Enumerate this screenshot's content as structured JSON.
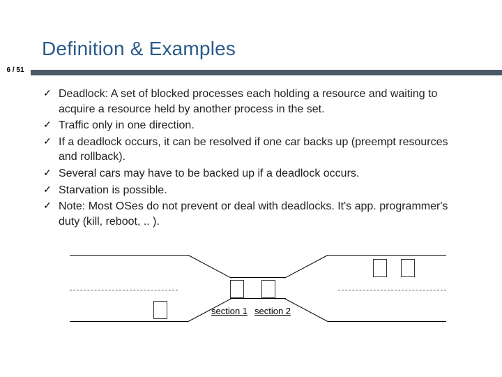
{
  "slide": {
    "title": "Definition & Examples",
    "page_counter": "6 / 51",
    "bullets": [
      "Deadlock: A set of blocked processes each holding a resource and waiting to acquire a resource held by another process in the set.",
      "Traffic only in one direction.",
      "If a deadlock occurs, it can be resolved if one car backs up (preempt resources and rollback).",
      "Several cars may have to be backed up if a deadlock occurs.",
      "Starvation is possible.",
      "Note: Most OSes do not prevent or deal with deadlocks. It's app. programmer's duty (kill, reboot, .. )."
    ]
  },
  "diagram": {
    "section_labels": [
      "section 1",
      "section 2"
    ],
    "cars": [
      {
        "id": "car-left-lower"
      },
      {
        "id": "car-mid-1"
      },
      {
        "id": "car-mid-2"
      },
      {
        "id": "car-right-1"
      },
      {
        "id": "car-right-2"
      }
    ]
  }
}
